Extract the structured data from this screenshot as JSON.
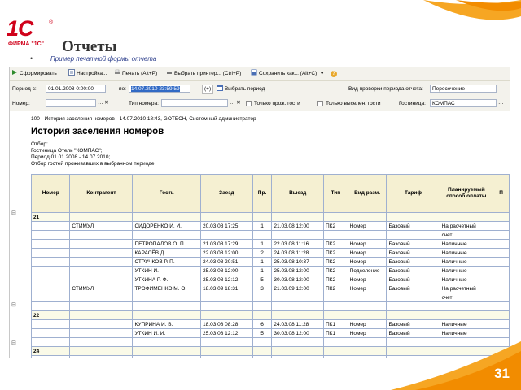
{
  "logo": {
    "main": "1С",
    "reg": "®",
    "sub": "ФИРМА \"1С\""
  },
  "slide": {
    "title": "Отчеты",
    "bullet": "Пример печатной формы отчета",
    "page_number": "31"
  },
  "toolbar": {
    "generate": "Сформировать",
    "settings": "Настройка...",
    "print": "Печать (Alt+P)",
    "select_printer": "Выбрать принтер... (Ctrl+P)",
    "save_as": "Сохранить как... (Alt+C)",
    "more": "▾"
  },
  "params": {
    "period_from_label": "Период с:",
    "period_from": "01.01.2008 0:00:00",
    "period_to_label": "по:",
    "period_to": "14.07.2010 23:59:59",
    "select_period": "Выбрать период",
    "check_type_label": "Вид проверки периода отчета:",
    "check_type": "Пересечение",
    "room_label": "Номер:",
    "room_type_label": "Тип номера:",
    "only_living_label": "Только прож. гости",
    "only_checked_out_label": "Только выселен. гости",
    "hotel_label": "Гостиница:",
    "hotel": "КОМПАС"
  },
  "report": {
    "header1": "100 - История заселения номеров - 14.07.2010 18:43, GOTECH, Системный администратор",
    "title": "История заселения номеров",
    "filter_label": "Отбор:",
    "filter1": "Гостиница Отель \"КОМПАС\";",
    "filter2": "Период 01.01.2008 - 14.07.2010;",
    "filter3": "Отбор гостей проживавших в выбранном периоде;",
    "columns": [
      "Номер",
      "Контрагент",
      "Гость",
      "Заезд",
      "Пр.",
      "Выезд",
      "Тип",
      "Вид разм.",
      "Тариф",
      "Планируемый способ оплаты",
      "П"
    ],
    "groups": [
      {
        "room": "21",
        "rows": [
          [
            "",
            "СТИМУЛ",
            "СИДОРЕНКО И. И.",
            "20.03.08 17:25",
            "1",
            "21.03.08 12:00",
            "ПК2",
            "Номер",
            "Базовый",
            "На расчетный",
            ""
          ],
          [
            "",
            "",
            "",
            "",
            "",
            "",
            "",
            "",
            "",
            "счет",
            ""
          ],
          [
            "",
            "",
            "ПЕТРОПАЛОВ О. П.",
            "21.03.08 17:29",
            "1",
            "22.03.08 11:16",
            "ПК2",
            "Номер",
            "Базовый",
            "Наличные",
            ""
          ],
          [
            "",
            "",
            "КАРАСЁВ Д.",
            "22.03.08 12:00",
            "2",
            "24.03.08 11:28",
            "ПК2",
            "Номер",
            "Базовый",
            "Наличные",
            ""
          ],
          [
            "",
            "",
            "СТРУЧКОВ Р. П.",
            "24.03.08 20:51",
            "1",
            "25.03.08 10:37",
            "ПК2",
            "Номер",
            "Базовый",
            "Наличные",
            ""
          ],
          [
            "",
            "",
            "УТКИН И.",
            "25.03.08 12:00",
            "1",
            "25.03.08 12:00",
            "ПК2",
            "Подселение",
            "Базовый",
            "Наличные",
            ""
          ],
          [
            "",
            "",
            "УТКИНА Р. Ф.",
            "25.03.08 12:12",
            "5",
            "30.03.08 12:00",
            "ПК2",
            "Номер",
            "Базовый",
            "Наличные",
            ""
          ],
          [
            "",
            "СТИМУЛ",
            "ТРОФИМЕНКО М. О.",
            "18.03.09 18:31",
            "3",
            "21.03.09 12:00",
            "ПК2",
            "Номер",
            "Базовый",
            "На расчетный",
            ""
          ],
          [
            "",
            "",
            "",
            "",
            "",
            "",
            "",
            "",
            "",
            "счет",
            ""
          ]
        ]
      },
      {
        "room": "22",
        "rows": [
          [
            "",
            "",
            "КУПРИНА И. В.",
            "18.03.08 08:28",
            "6",
            "24.03.08 11:28",
            "ПК1",
            "Номер",
            "Базовый",
            "Наличные",
            ""
          ],
          [
            "",
            "",
            "УТКИН И. И.",
            "25.03.08 12:12",
            "5",
            "30.03.08 12:00",
            "ПК1",
            "Номер",
            "Базовый",
            "Наличные",
            ""
          ],
          [
            "",
            "",
            "",
            "",
            "",
            "",
            "",
            "",
            "",
            "",
            ""
          ]
        ]
      },
      {
        "room": "24",
        "rows": [
          [
            "",
            "",
            "",
            "",
            "",
            "",
            "",
            "",
            "",
            "",
            ""
          ]
        ]
      }
    ]
  },
  "colors": {
    "accent": "#f28c00",
    "brand": "#d0021b",
    "header_bg": "#f5f0d2",
    "grid": "#9fb0d0"
  }
}
